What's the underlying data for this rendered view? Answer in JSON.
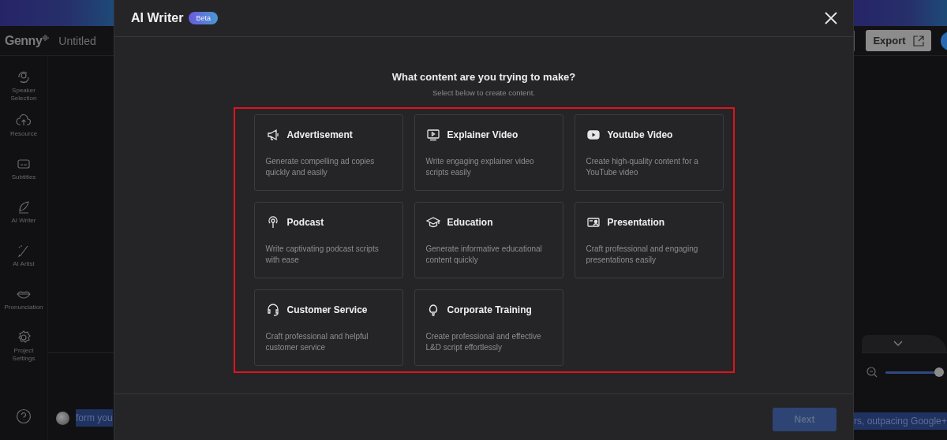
{
  "app": {
    "logo": "Genny",
    "project_title": "Untitled",
    "export_button": "Export",
    "sidebar": [
      {
        "label": "Speaker Selection"
      },
      {
        "label": "Resource"
      },
      {
        "label": "Subtitles"
      },
      {
        "label": "AI Writer"
      },
      {
        "label": "AI Artist"
      },
      {
        "label": "Pronunciation"
      },
      {
        "label": "Project Settings"
      }
    ],
    "script_text_left": "form you",
    "script_text_right": "rs, outpacing Google+",
    "zoom_slider": {
      "level": 0.97
    }
  },
  "dialog": {
    "title": "AI Writer",
    "badge": "Beta",
    "heading": "What content are you trying to make?",
    "subheading": "Select below to create content.",
    "options": [
      {
        "title": "Advertisement",
        "description": "Generate compelling ad copies quickly and easily"
      },
      {
        "title": "Explainer Video",
        "description": "Write engaging explainer video scripts easily"
      },
      {
        "title": "Youtube Video",
        "description": "Create high-quality content for a YouTube video"
      },
      {
        "title": "Podcast",
        "description": "Write captivating podcast scripts with ease"
      },
      {
        "title": "Education",
        "description": "Generate informative educational content quickly"
      },
      {
        "title": "Presentation",
        "description": "Craft professional and engaging presentations easily"
      },
      {
        "title": "Customer Service",
        "description": "Craft professional and helpful customer service"
      },
      {
        "title": "Corporate Training",
        "description": "Create professional and effective L&D script effortlessly"
      }
    ],
    "next_button": {
      "label": "Next",
      "disabled": true
    }
  }
}
